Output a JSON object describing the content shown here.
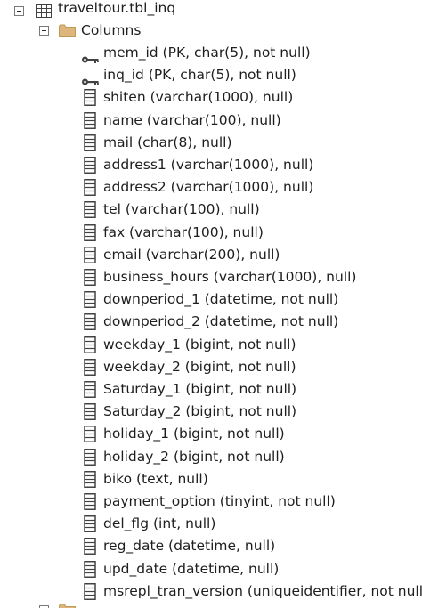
{
  "tree": {
    "table": {
      "label": "traveltour.tbl_inq",
      "icon": "table-icon",
      "expanded": true
    },
    "columns_folder": {
      "label": "Columns",
      "icon": "folder-icon",
      "expanded": true
    },
    "columns": [
      {
        "label": "mem_id (PK, char(5), not null)",
        "icon": "primary-key-icon"
      },
      {
        "label": "inq_id (PK, char(5), not null)",
        "icon": "primary-key-icon"
      },
      {
        "label": "shiten (varchar(1000), null)",
        "icon": "column-icon"
      },
      {
        "label": "name (varchar(100), null)",
        "icon": "column-icon"
      },
      {
        "label": "mail (char(8), null)",
        "icon": "column-icon"
      },
      {
        "label": "address1 (varchar(1000), null)",
        "icon": "column-icon"
      },
      {
        "label": "address2 (varchar(1000), null)",
        "icon": "column-icon"
      },
      {
        "label": "tel (varchar(100), null)",
        "icon": "column-icon"
      },
      {
        "label": "fax (varchar(100), null)",
        "icon": "column-icon"
      },
      {
        "label": "email (varchar(200), null)",
        "icon": "column-icon"
      },
      {
        "label": "business_hours (varchar(1000), null)",
        "icon": "column-icon"
      },
      {
        "label": "downperiod_1 (datetime, not null)",
        "icon": "column-icon"
      },
      {
        "label": "downperiod_2 (datetime, not null)",
        "icon": "column-icon"
      },
      {
        "label": "weekday_1 (bigint, not null)",
        "icon": "column-icon"
      },
      {
        "label": "weekday_2 (bigint, not null)",
        "icon": "column-icon"
      },
      {
        "label": "Saturday_1 (bigint, not null)",
        "icon": "column-icon"
      },
      {
        "label": "Saturday_2 (bigint, not null)",
        "icon": "column-icon"
      },
      {
        "label": "holiday_1 (bigint, not null)",
        "icon": "column-icon"
      },
      {
        "label": "holiday_2 (bigint, not null)",
        "icon": "column-icon"
      },
      {
        "label": "biko (text, null)",
        "icon": "column-icon"
      },
      {
        "label": "payment_option (tinyint, not null)",
        "icon": "column-icon"
      },
      {
        "label": "del_flg (int, null)",
        "icon": "column-icon"
      },
      {
        "label": "reg_date (datetime, null)",
        "icon": "column-icon"
      },
      {
        "label": "upd_date (datetime, null)",
        "icon": "column-icon"
      },
      {
        "label": "msrepl_tran_version (uniqueidentifier, not null)",
        "icon": "column-icon"
      }
    ],
    "next_folder": {
      "label": "",
      "icon": "folder-icon",
      "expanded": false
    }
  },
  "colors": {
    "text": "#1e1e1e",
    "folder": "#dcb67a",
    "icon_stroke": "#424242"
  }
}
